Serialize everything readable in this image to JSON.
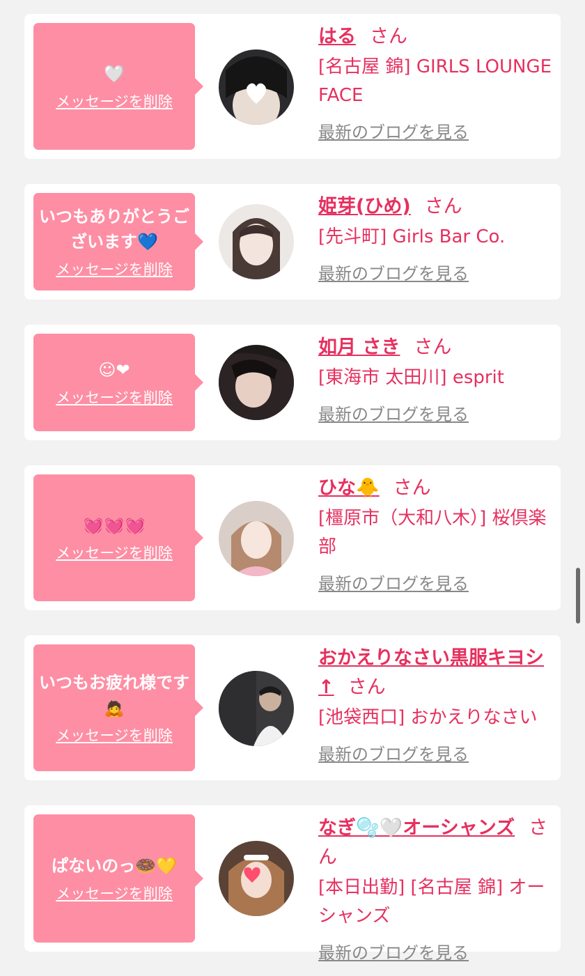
{
  "labels": {
    "delete_message": "メッセージを削除",
    "honorific": "さん",
    "view_blog": "最新のブログを見る"
  },
  "colors": {
    "page_bg": "#f2f2f2",
    "bubble_bg": "#fe8ea4",
    "accent": "#e6305f",
    "link_gray": "#888888"
  },
  "items": [
    {
      "message": "🤍",
      "name": "はる",
      "shop": "[名古屋 錦] GIRLS LOUNGE FACE"
    },
    {
      "message": "いつもありがとうございます💙",
      "name": "姫芽(ひめ)",
      "shop": "[先斗町] Girls Bar Co."
    },
    {
      "message": "☺︎❤",
      "name": "如月 さき",
      "shop": "[東海市 太田川] esprit"
    },
    {
      "message": "💓💓💓",
      "name": "ひな🐥",
      "shop": "[橿原市（大和八木）] 桜倶楽部"
    },
    {
      "message": "いつもお疲れ様です🙇",
      "name": "おかえりなさい黒服キヨシ↑",
      "shop": "[池袋西口] おかえりなさい"
    },
    {
      "message": "ぱないのっ🍩💛",
      "name": "なぎ🫧🤍オーシャンズ",
      "shop": "[本日出勤] [名古屋 錦] オーシャンズ"
    }
  ]
}
